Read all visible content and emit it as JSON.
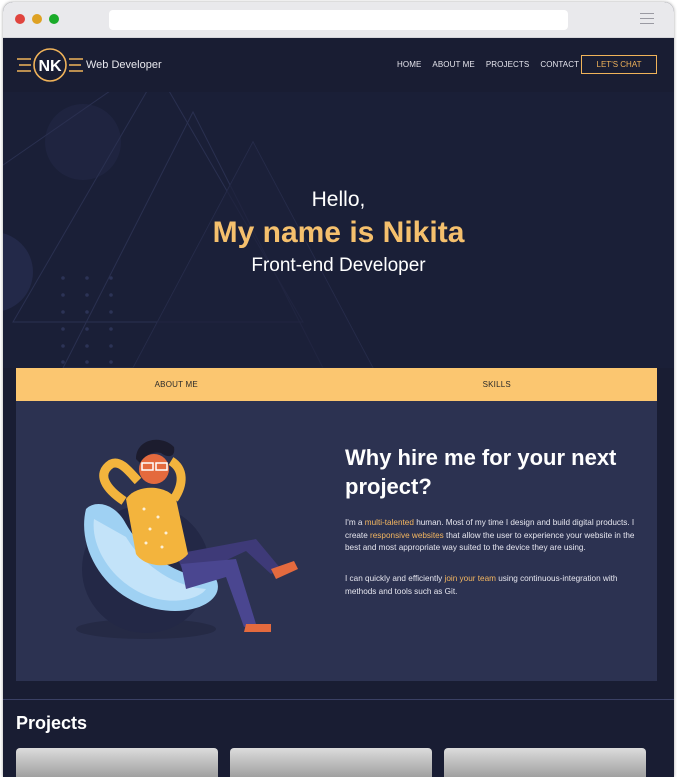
{
  "nav": {
    "logo_text": "NK",
    "brand": "Web Developer",
    "links": [
      "HOME",
      "ABOUT ME",
      "PROJECTS",
      "CONTACT"
    ],
    "cta": "LET'S CHAT"
  },
  "hero": {
    "line1": "Hello,",
    "line2": "My name is Nikita",
    "line3": "Front-end Developer"
  },
  "tabs": [
    "ABOUT ME",
    "SKILLS"
  ],
  "about": {
    "heading": "Why hire me for your next project?",
    "p1_a": "I'm a ",
    "p1_hl1": "multi-talented",
    "p1_b": " human. Most of my time I design and build digital products. I create ",
    "p1_hl2": "responsive websites",
    "p1_c": " that allow the user to experience your website in the best and most appropriate way suited to the device they are using.",
    "p2_a": "I can quickly and efficiently ",
    "p2_hl": "join your team",
    "p2_b": " using continuous-integration with methods and tools such as Git."
  },
  "projects": {
    "title": "Projects"
  },
  "colors": {
    "background": "#191d33",
    "accent": "#fbc670",
    "panel": "#2c3251"
  }
}
